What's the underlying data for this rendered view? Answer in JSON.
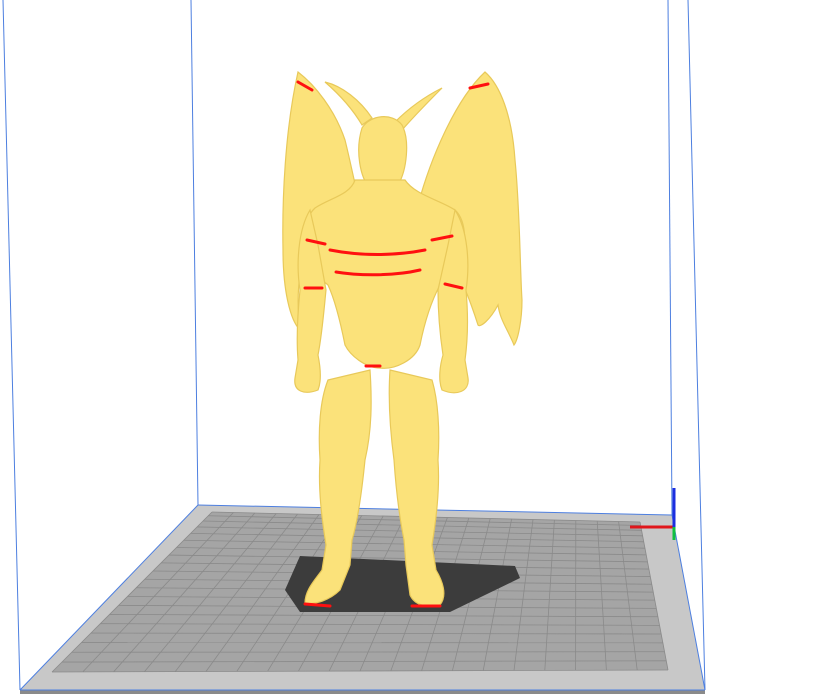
{
  "viewport": {
    "background": "#ffffff"
  },
  "build_volume": {
    "edge_color": "#4d7fe0"
  },
  "build_plate": {
    "outer_color": "#c8c8c8",
    "inner_color": "#a5a5a5",
    "grid_line_color": "#8a8a8a",
    "grid_divisions": 20
  },
  "model": {
    "icon": "winged-figure-model",
    "color": "#fbe27a",
    "shade_color": "#e8c95a",
    "overhang_color": "#ff1010",
    "shadow_color": "#3c3c3c"
  },
  "axes": {
    "x_color": "#e0161b",
    "y_color": "#10c040",
    "z_color": "#1b2fe0"
  }
}
